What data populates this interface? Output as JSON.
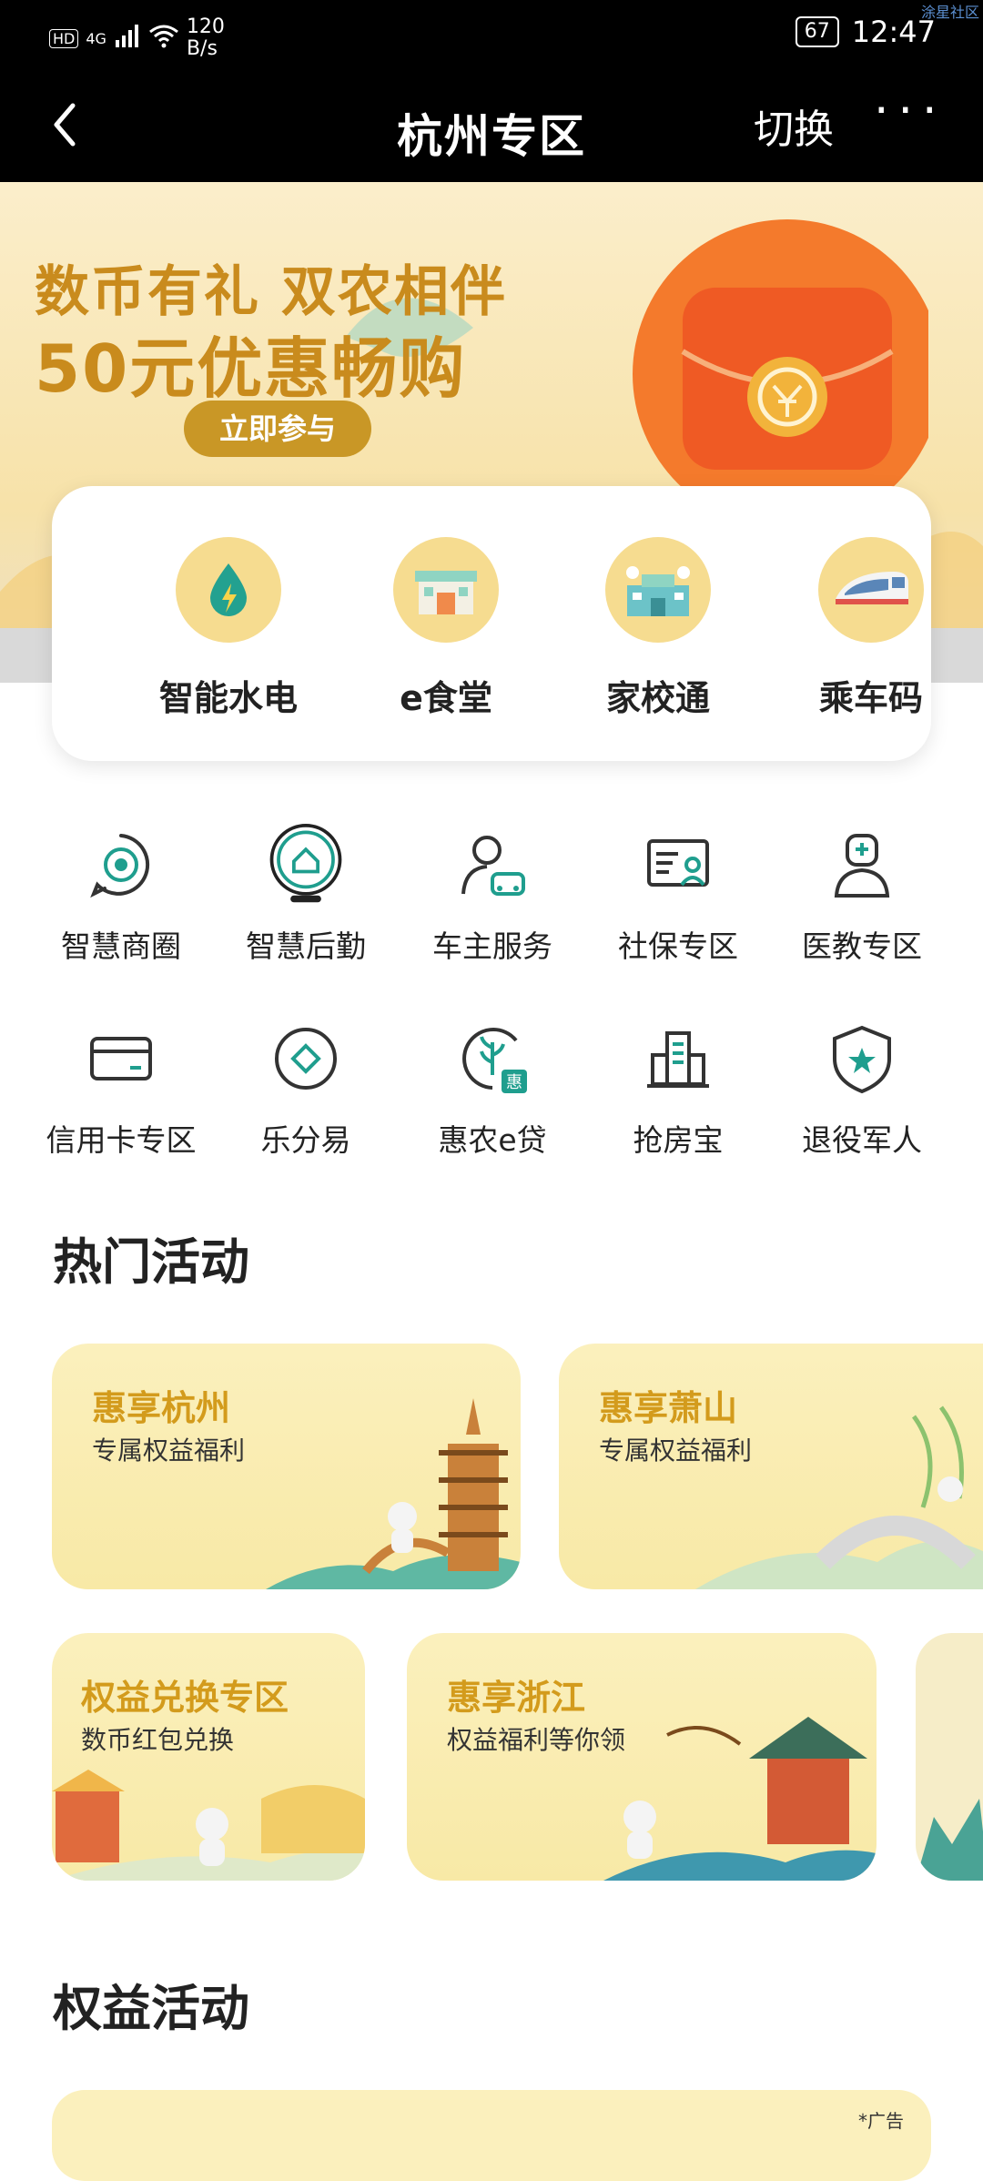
{
  "status_bar": {
    "hd": "HD",
    "signal": "4G",
    "net_speed_value": "120",
    "net_speed_unit": "B/s",
    "battery": "67",
    "time": "12:47"
  },
  "watermark": "涂星社区",
  "nav": {
    "title": "杭州专区",
    "switch_label": "切换",
    "more_label": "···"
  },
  "banner": {
    "title_line1": "数币有礼 双农相伴",
    "title_line2": "50元优惠畅购",
    "cta": "立即参与",
    "accent_color": "#c98b1d"
  },
  "quick_services": [
    {
      "label": "智能水电",
      "icon": "water-electric-icon"
    },
    {
      "label": "e食堂",
      "icon": "canteen-icon"
    },
    {
      "label": "家校通",
      "icon": "school-icon"
    },
    {
      "label": "乘车码",
      "icon": "train-icon"
    }
  ],
  "grid_services": [
    {
      "label": "智慧商圈",
      "icon": "business-circle-icon"
    },
    {
      "label": "智慧后勤",
      "icon": "logistics-home-icon"
    },
    {
      "label": "车主服务",
      "icon": "car-owner-icon"
    },
    {
      "label": "社保专区",
      "icon": "social-security-icon"
    },
    {
      "label": "医教专区",
      "icon": "doctor-icon"
    },
    {
      "label": "信用卡专区",
      "icon": "credit-card-icon"
    },
    {
      "label": "乐分易",
      "icon": "diamond-icon"
    },
    {
      "label": "惠农e贷",
      "icon": "agri-loan-icon"
    },
    {
      "label": "抢房宝",
      "icon": "building-icon"
    },
    {
      "label": "退役军人",
      "icon": "shield-star-icon"
    }
  ],
  "hot_section_title": "热门活动",
  "hot_activities": [
    {
      "title": "惠享杭州",
      "subtitle": "专属权益福利"
    },
    {
      "title": "惠享萧山",
      "subtitle": "专属权益福利"
    },
    {
      "title": "权益兑换专区",
      "subtitle": "数币红包兑换"
    },
    {
      "title": "惠享浙江",
      "subtitle": "权益福利等你领"
    }
  ],
  "rights_section_title": "权益活动",
  "ad_label": "*广告",
  "theme": {
    "teal": "#1f9e8e",
    "gold": "#d39b1c",
    "card_bg": "#fbf0bd"
  }
}
